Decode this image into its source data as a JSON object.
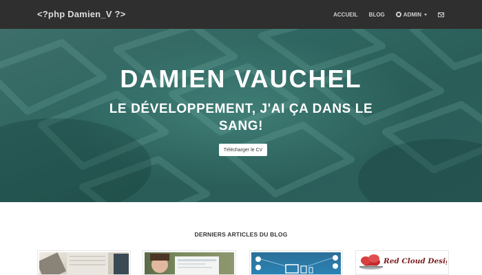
{
  "navbar": {
    "brand": "<?php Damien_V ?>",
    "items": [
      {
        "label": "ACCUEIL"
      },
      {
        "label": "BLOG"
      },
      {
        "label": "ADMIN"
      }
    ]
  },
  "hero": {
    "title": "DAMIEN VAUCHEL",
    "subtitle": "LE DÉVELOPPEMENT, J'AI ÇA DANS LE SANG!",
    "cv_button": "Télécharger le CV"
  },
  "articles": {
    "heading": "DERNIERS ARTICLES DU BLOG",
    "cards": [
      {
        "image": "desk-keyboard-photo"
      },
      {
        "image": "person-laptop-photo"
      },
      {
        "image": "responsive-devices-illustration"
      },
      {
        "image": "red-cloud-design-logo",
        "logo_text": "Red Cloud Design"
      }
    ]
  },
  "colors": {
    "navbar_bg": "#2f2f2f",
    "hero_tint": "#2f6560",
    "logo_red": "#c62828"
  }
}
